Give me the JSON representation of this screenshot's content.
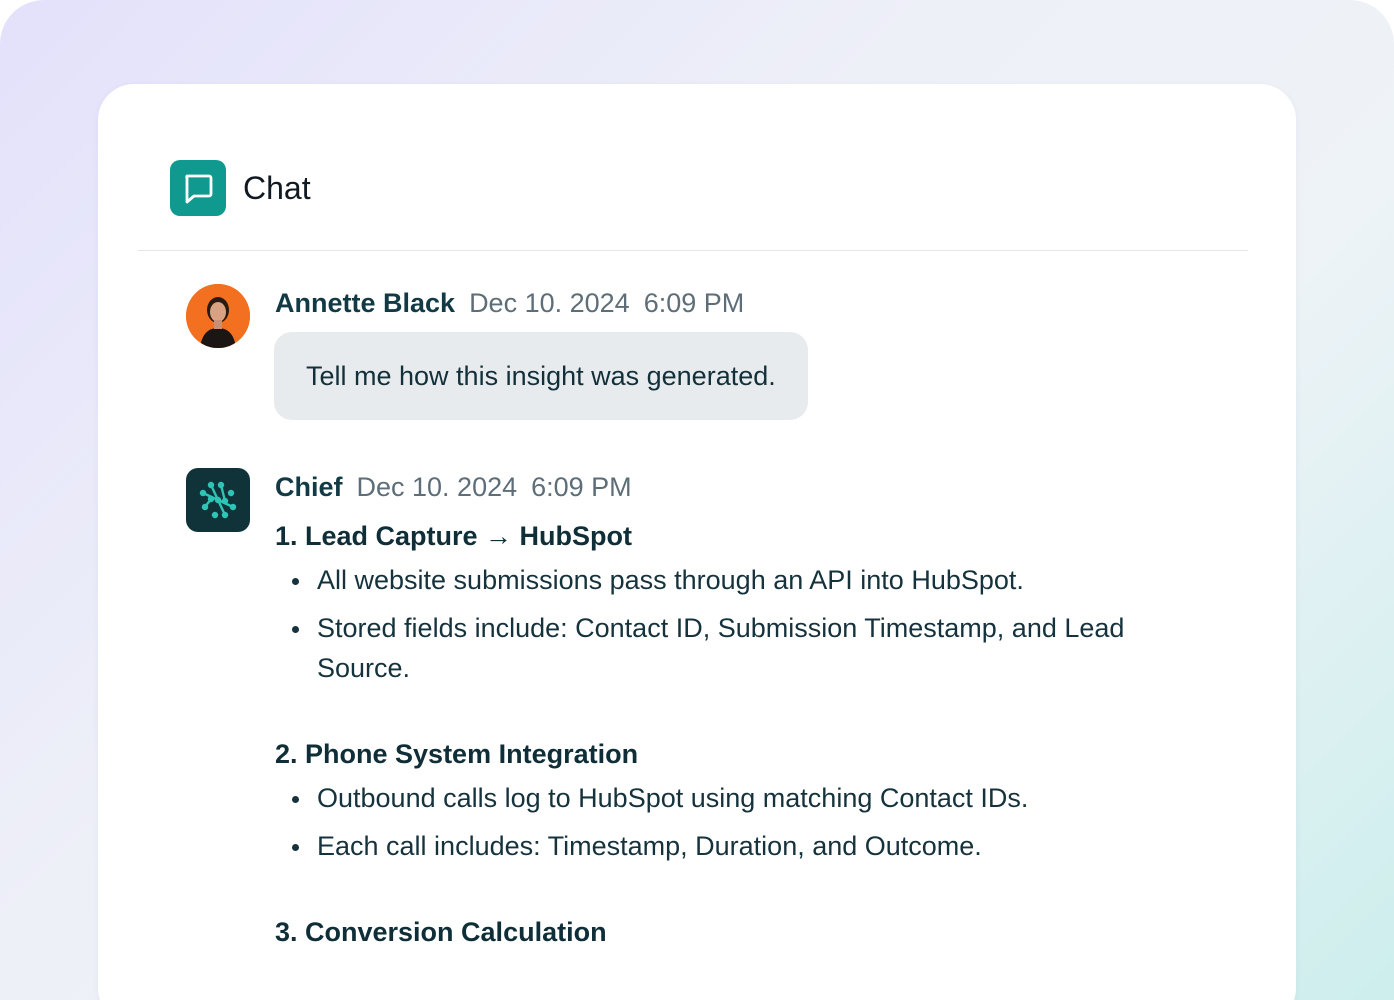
{
  "header": {
    "title": "Chat",
    "icon": "chat-bubble-icon",
    "icon_color": "#109a8f"
  },
  "messages": [
    {
      "sender": "Annette Black",
      "date": "Dec 10. 2024",
      "time": "6:09 PM",
      "text": "Tell me how this insight was generated."
    },
    {
      "sender": "Chief",
      "date": "Dec 10. 2024",
      "time": "6:09 PM",
      "sections": [
        {
          "title": "1. Lead Capture → HubSpot",
          "bullets": [
            "All website submissions pass through an API into HubSpot.",
            "Stored fields include: Contact ID, Submission Timestamp, and Lead Source."
          ]
        },
        {
          "title": "2. Phone System Integration",
          "bullets": [
            "Outbound calls log to HubSpot using matching Contact IDs.",
            "Each call includes: Timestamp, Duration, and Outcome."
          ]
        },
        {
          "title": "3. Conversion Calculation",
          "bullets": []
        }
      ]
    }
  ],
  "colors": {
    "accent_teal": "#109a8f",
    "bot_avatar_bg": "#10333a",
    "user_avatar_bg": "#f37021"
  }
}
